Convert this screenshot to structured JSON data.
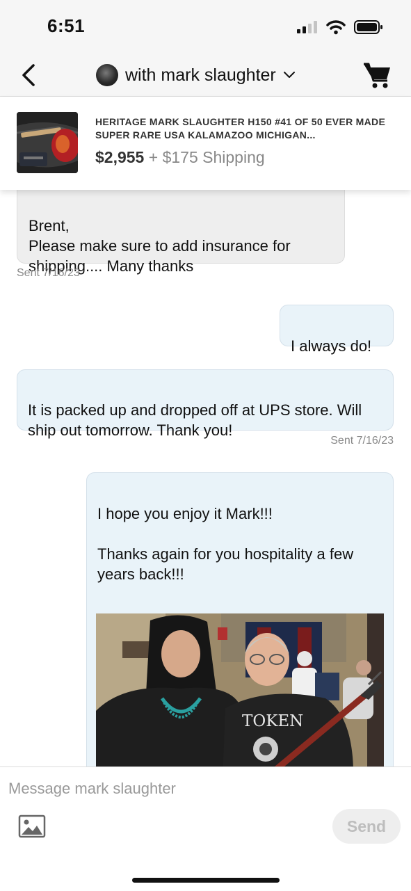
{
  "status_bar": {
    "time": "6:51"
  },
  "header": {
    "title": "with mark slaughter",
    "icons": {
      "back": "chevron-left-icon",
      "dropdown": "chevron-down-icon",
      "cart": "cart-icon"
    }
  },
  "listing": {
    "title": "Heritage MARK SLAUGHTER H150 #41 OF 50 EVER MADE SUPER RARE USA KALAMAZOO MICHIGAN...",
    "price": "$2,955",
    "shipping": " + $175 Shipping"
  },
  "messages": [
    {
      "text": "Brent,\nPlease make sure to add insurance for shipping.... Many thanks",
      "sent": "Sent 7/16/23"
    },
    {
      "text": "I always do!"
    },
    {
      "text": "It is packed up and dropped off at UPS store. Will ship out tomorrow. Thank you!",
      "sent": "Sent 7/16/23"
    },
    {
      "text": "I hope you enjoy it Mark!!!\n\nThanks again for you hospitality a few years back!!!",
      "photo_shirt_text": "TOKEN"
    }
  ],
  "composer": {
    "placeholder": "Message mark slaughter",
    "send_label": "Send",
    "image_icon": "image-icon"
  },
  "colors": {
    "sent_bubble": "#e9f3f9",
    "received_bubble": "#eeeeee",
    "send_button": "#eeeeee"
  }
}
